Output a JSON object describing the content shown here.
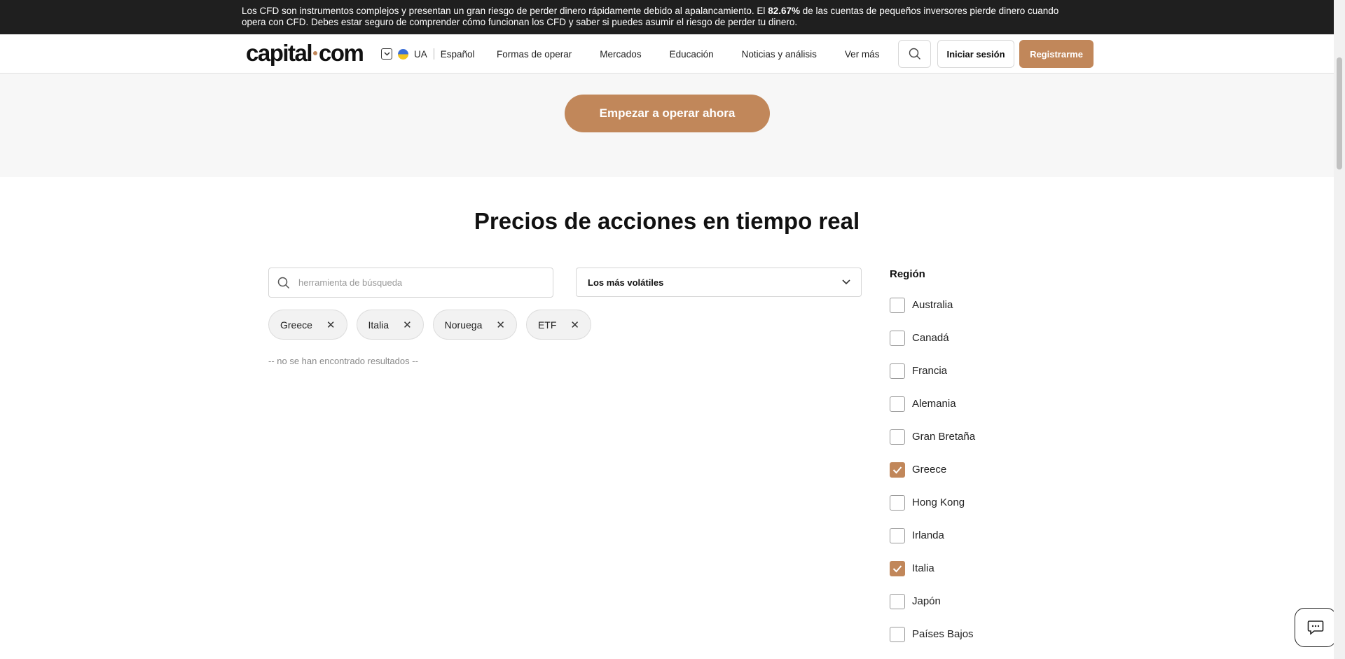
{
  "risk_warning": {
    "prefix": "Los CFD son instrumentos complejos y presentan un gran riesgo de perder dinero rápidamente debido al apalancamiento. El ",
    "percent": "82.67%",
    "suffix": " de las cuentas de pequeños inversores pierde dinero cuando opera con CFD. Debes estar seguro de comprender cómo funcionan los CFD y saber si puedes asumir el riesgo de perder tu dinero."
  },
  "header": {
    "logo_left": "capital",
    "logo_right": "com",
    "country": "UA",
    "language": "Español",
    "nav": [
      "Formas de operar",
      "Mercados",
      "Educación",
      "Noticias y análisis",
      "Ver más"
    ],
    "login": "Iniciar sesión",
    "register": "Registrarme"
  },
  "hero": {
    "cta": "Empezar a operar ahora"
  },
  "main": {
    "title": "Precios de acciones en tiempo real",
    "search_placeholder": "herramienta de búsqueda",
    "sort_value": "Los más volátiles",
    "chips": [
      "Greece",
      "Italia",
      "Noruega",
      "ETF"
    ],
    "no_results": "-- no se han encontrado resultados --"
  },
  "region": {
    "heading": "Región",
    "items": [
      {
        "label": "Australia",
        "checked": false
      },
      {
        "label": "Canadá",
        "checked": false
      },
      {
        "label": "Francia",
        "checked": false
      },
      {
        "label": "Alemania",
        "checked": false
      },
      {
        "label": "Gran Bretaña",
        "checked": false
      },
      {
        "label": "Greece",
        "checked": true
      },
      {
        "label": "Hong Kong",
        "checked": false
      },
      {
        "label": "Irlanda",
        "checked": false
      },
      {
        "label": "Italia",
        "checked": true
      },
      {
        "label": "Japón",
        "checked": false
      },
      {
        "label": "Países Bajos",
        "checked": false
      }
    ]
  },
  "colors": {
    "accent": "#c1875a",
    "dark_bar": "#1f1f1f"
  }
}
